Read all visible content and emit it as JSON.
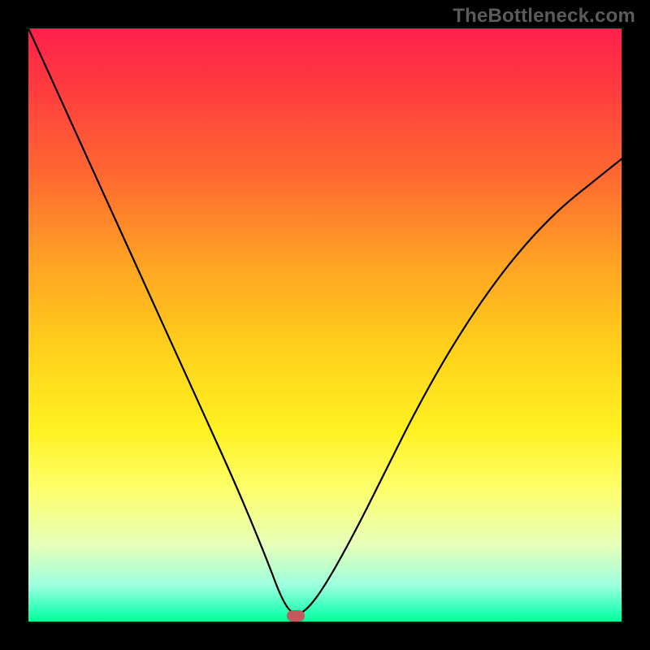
{
  "watermark": "TheBottleneck.com",
  "chart_data": {
    "type": "line",
    "title": "",
    "xlabel": "",
    "ylabel": "",
    "xlim": [
      0,
      100
    ],
    "ylim": [
      0,
      100
    ],
    "series": [
      {
        "name": "bottleneck-curve",
        "x": [
          0,
          5,
          10,
          15,
          20,
          25,
          30,
          35,
          40,
          43,
          45,
          47,
          50,
          55,
          60,
          65,
          70,
          75,
          80,
          85,
          90,
          95,
          100
        ],
        "values": [
          100,
          89,
          78,
          67,
          56,
          45,
          34,
          23,
          11,
          3,
          1,
          2,
          6,
          15,
          25,
          35,
          44,
          52,
          59,
          65,
          70,
          74,
          78
        ]
      }
    ],
    "minimum": {
      "x": 45,
      "y": 1
    },
    "marker_color": "#c05a5d",
    "gradient_stops": [
      {
        "pos": 0,
        "color": "#ff1f4c"
      },
      {
        "pos": 25,
        "color": "#ff6a30"
      },
      {
        "pos": 55,
        "color": "#ffd31a"
      },
      {
        "pos": 78,
        "color": "#fdff6e"
      },
      {
        "pos": 100,
        "color": "#00ff96"
      }
    ]
  }
}
